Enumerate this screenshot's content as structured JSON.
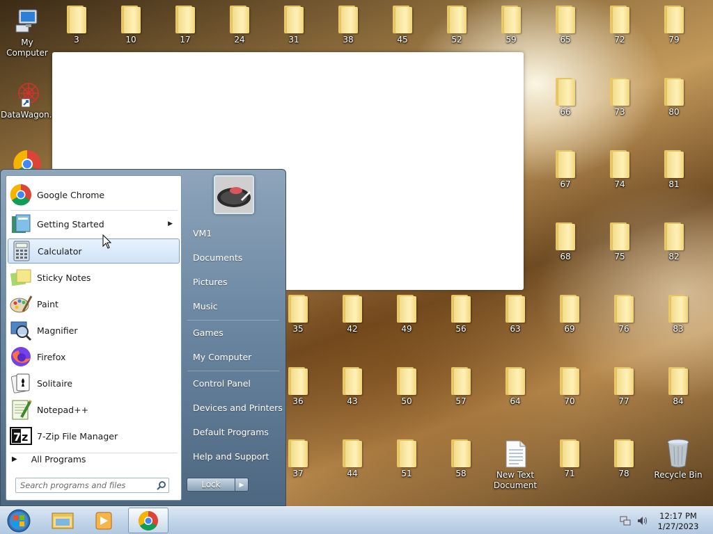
{
  "desktop": {
    "my_computer": "My Computer",
    "datawagon": "DataWagon...",
    "new_text_document": "New Text Document",
    "recycle_bin": "Recycle Bin",
    "folders": {
      "f3": "3",
      "f10": "10",
      "f17": "17",
      "f24": "24",
      "f31": "31",
      "f38": "38",
      "f45": "45",
      "f52": "52",
      "f59": "59",
      "f65": "65",
      "f72": "72",
      "f79": "79",
      "f66": "66",
      "f73": "73",
      "f80": "80",
      "f67": "67",
      "f74": "74",
      "f81": "81",
      "f68": "68",
      "f75": "75",
      "f82": "82",
      "f35": "35",
      "f42": "42",
      "f49": "49",
      "f56": "56",
      "f63": "63",
      "f69": "69",
      "f76": "76",
      "f83": "83",
      "f36": "36",
      "f43": "43",
      "f50": "50",
      "f57": "57",
      "f64": "64",
      "f70": "70",
      "f77": "77",
      "f84": "84",
      "f37": "37",
      "f44": "44",
      "f51": "51",
      "f58": "58",
      "f71": "71",
      "f78": "78"
    }
  },
  "start_menu": {
    "programs": {
      "chrome": "Google Chrome",
      "getting_started": "Getting Started",
      "calculator": "Calculator",
      "sticky_notes": "Sticky Notes",
      "paint": "Paint",
      "magnifier": "Magnifier",
      "firefox": "Firefox",
      "solitaire": "Solitaire",
      "notepadpp": "Notepad++",
      "sevenzip": "7-Zip File Manager"
    },
    "all_programs": "All Programs",
    "search_placeholder": "Search programs and files",
    "right": {
      "user": "VM1",
      "documents": "Documents",
      "pictures": "Pictures",
      "music": "Music",
      "games": "Games",
      "my_computer": "My Computer",
      "control_panel": "Control Panel",
      "devices_printers": "Devices and Printers",
      "default_programs": "Default Programs",
      "help_support": "Help and Support"
    },
    "lock_label": "Lock"
  },
  "taskbar": {
    "time": "12:17 PM",
    "date": "1/27/2023"
  },
  "colors": {
    "folder": "#f2dc8c",
    "start_menu": "#6f8aa4",
    "highlight": "#cfe3f8"
  }
}
